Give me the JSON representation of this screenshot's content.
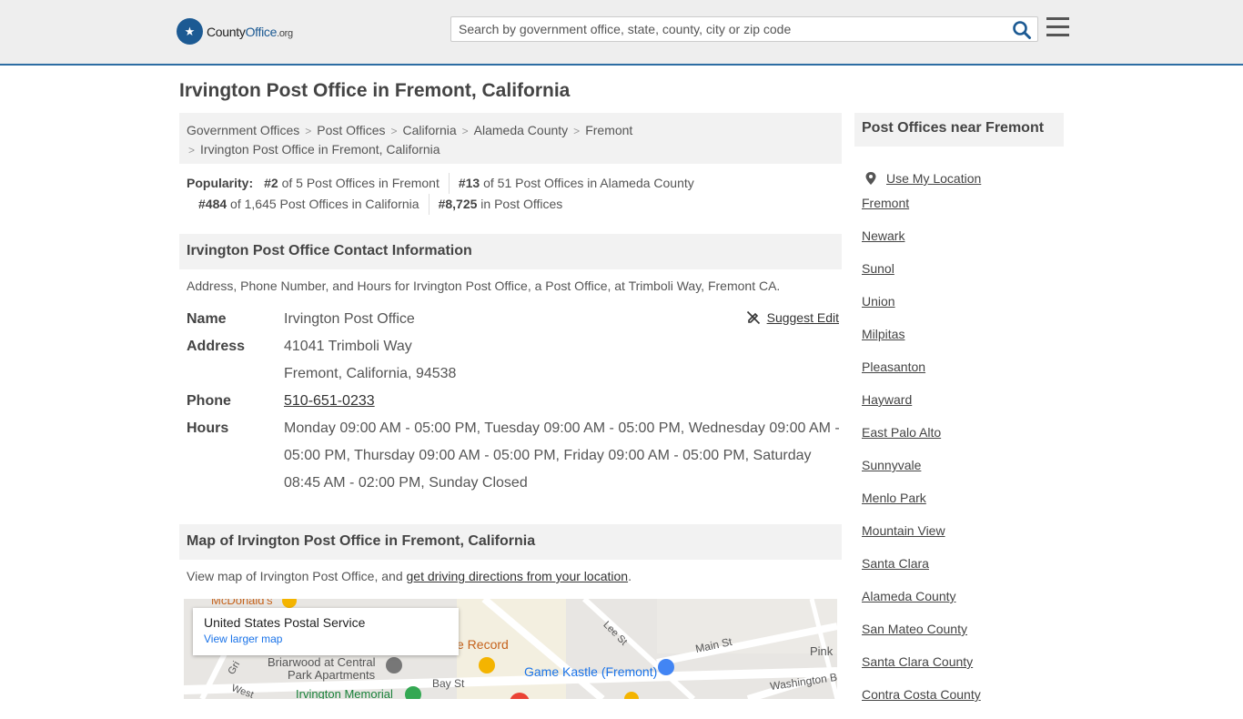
{
  "header": {
    "logo": {
      "pre": "County",
      "accent": "Office",
      "tld": ".org"
    },
    "search_placeholder": "Search by government office, state, county, city or zip code"
  },
  "page_title": "Irvington Post Office in Fremont, California",
  "breadcrumb": [
    "Government Offices",
    "Post Offices",
    "California",
    "Alameda County",
    "Fremont",
    "Irvington Post Office in Fremont, California"
  ],
  "popularity": {
    "label": "Popularity:",
    "items": [
      {
        "rank": "#2",
        "text": "of 5 Post Offices in Fremont"
      },
      {
        "rank": "#13",
        "text": "of 51 Post Offices in Alameda County"
      },
      {
        "rank": "#484",
        "text": "of 1,645 Post Offices in California"
      },
      {
        "rank": "#8,725",
        "text": "in Post Offices"
      }
    ]
  },
  "contact": {
    "heading": "Irvington Post Office Contact Information",
    "description": "Address, Phone Number, and Hours for Irvington Post Office, a Post Office, at Trimboli Way, Fremont CA.",
    "suggest_edit": "Suggest Edit",
    "labels": {
      "name": "Name",
      "address": "Address",
      "phone": "Phone",
      "hours": "Hours"
    },
    "name": "Irvington Post Office",
    "address_line1": "41041 Trimboli Way",
    "address_line2": "Fremont, California, 94538",
    "phone": "510-651-0233",
    "hours": "Monday 09:00 AM - 05:00 PM, Tuesday 09:00 AM - 05:00 PM, Wednesday 09:00 AM - 05:00 PM, Thursday 09:00 AM - 05:00 PM, Friday 09:00 AM - 05:00 PM, Saturday 08:45 AM - 02:00 PM, Sunday Closed"
  },
  "map_section": {
    "heading": "Map of Irvington Post Office in Fremont, California",
    "desc_prefix": "View map of Irvington Post Office, and ",
    "desc_link": "get driving directions from your location",
    "desc_suffix": ".",
    "card_title": "United States Postal Service",
    "card_link": "View larger map",
    "labels": [
      "McDonald's",
      "e Record",
      "Lee St",
      "Main St",
      "Pink",
      "Briarwood at Central",
      "Park Apartments",
      "Game Kastle (Fremont)",
      "Bay St",
      "Washington B",
      "Irvington Memorial",
      "Gri",
      "West"
    ]
  },
  "sidebar": {
    "heading": "Post Offices near Fremont",
    "use_location": "Use My Location",
    "items": [
      "Fremont",
      "Newark",
      "Sunol",
      "Union",
      "Milpitas",
      "Pleasanton",
      "Hayward",
      "East Palo Alto",
      "Sunnyvale",
      "Menlo Park",
      "Mountain View",
      "Santa Clara",
      "Alameda County",
      "San Mateo County",
      "Santa Clara County",
      "Contra Costa County"
    ]
  },
  "colors": {
    "brand": "#1c5a93",
    "header_bg": "#eeeeee",
    "panel_bg": "#f2f2f2"
  }
}
